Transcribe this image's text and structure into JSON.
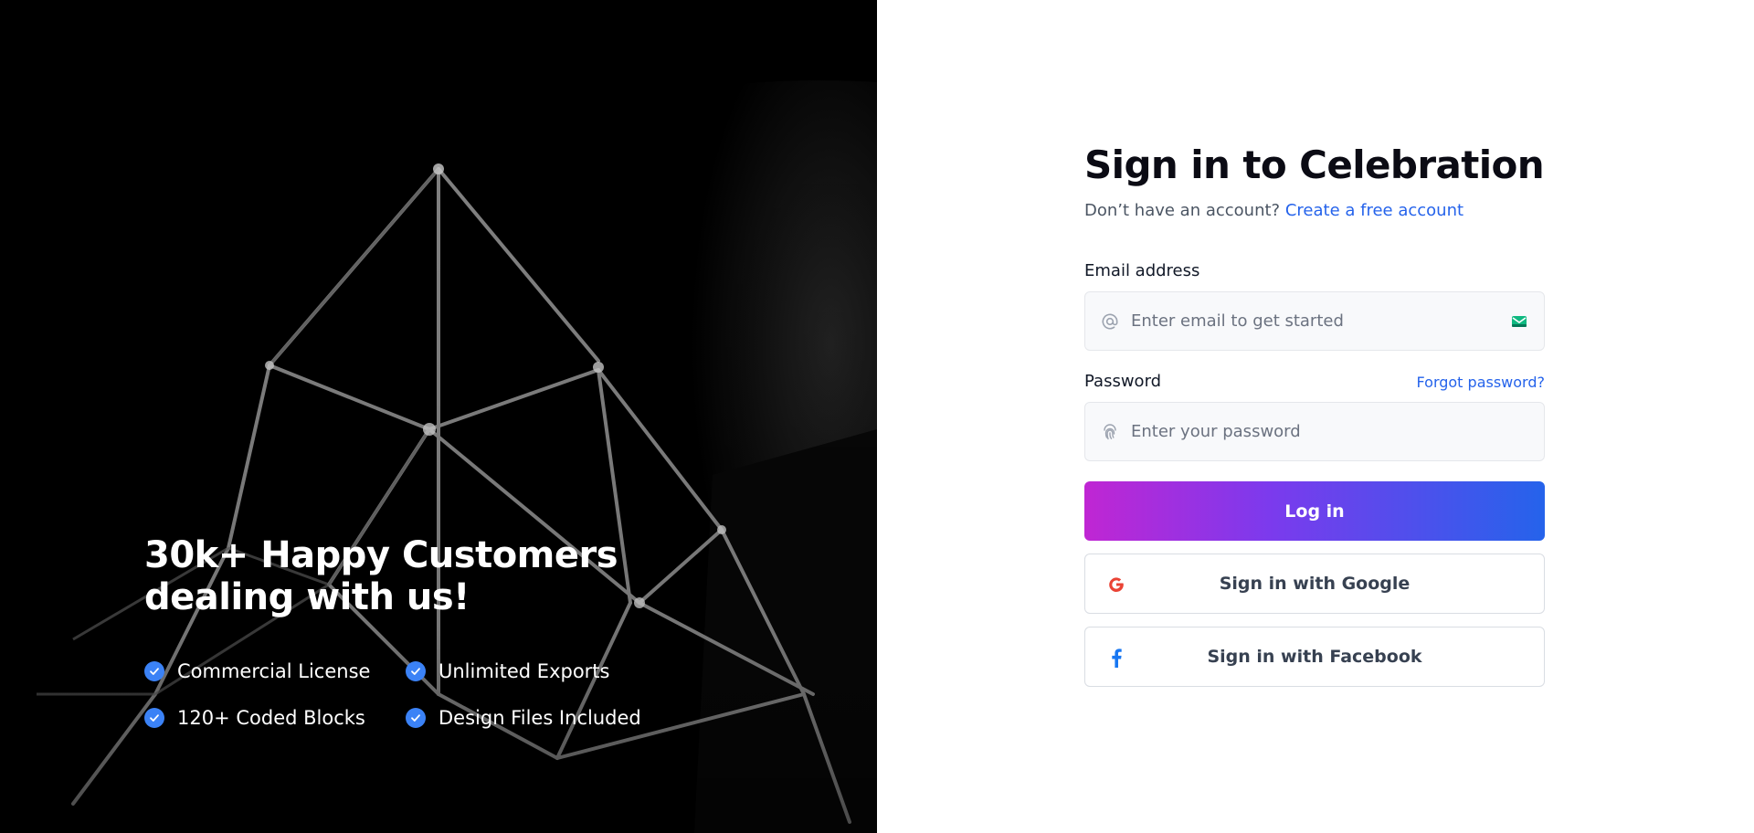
{
  "hero": {
    "headline_line1": "30k+ Happy Customers",
    "headline_line2": "dealing with us!",
    "features": [
      {
        "label": "Commercial License"
      },
      {
        "label": "Unlimited Exports"
      },
      {
        "label": "120+ Coded Blocks"
      },
      {
        "label": "Design Files Included"
      }
    ],
    "check_color": "#3b82f6"
  },
  "form": {
    "title": "Sign in to Celebration",
    "subtitle_text": "Don’t have an account?",
    "subtitle_link": "Create a free account",
    "email": {
      "label": "Email address",
      "placeholder": "Enter email to get started",
      "value": "",
      "icon": "at-icon",
      "trailing_icon": "mail-badge-icon"
    },
    "password": {
      "label": "Password",
      "forgot_link": "Forgot password?",
      "placeholder": "Enter your password",
      "value": "",
      "icon": "fingerprint-icon"
    },
    "login_button": "Log in",
    "google_button": "Sign in with Google",
    "facebook_button": "Sign in with Facebook",
    "colors": {
      "link": "#2563eb",
      "gradient_start": "#c026d3",
      "gradient_end": "#2563eb",
      "google": "#ea4335",
      "facebook": "#1877f2"
    }
  }
}
